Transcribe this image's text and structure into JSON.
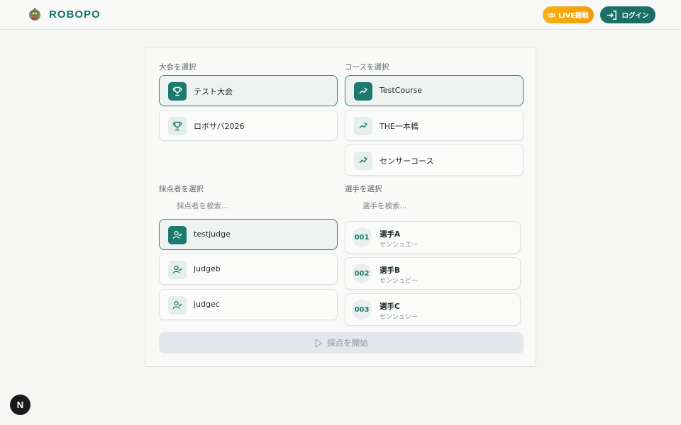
{
  "header": {
    "brand": "ROBOPO",
    "live_label": "LIVE観戦",
    "login_label": "ログイン"
  },
  "tournament": {
    "label": "大会を選択",
    "items": [
      {
        "label": "テスト大会",
        "selected": true
      },
      {
        "label": "ロボサバ2026",
        "selected": false
      }
    ]
  },
  "course": {
    "label": "コースを選択",
    "items": [
      {
        "label": "TestCourse",
        "selected": true
      },
      {
        "label": "THE一本橋",
        "selected": false
      },
      {
        "label": "センサーコース",
        "selected": false
      }
    ]
  },
  "judge": {
    "label": "採点者を選択",
    "search_placeholder": "採点者を検索...",
    "items": [
      {
        "label": "testjudge",
        "selected": true
      },
      {
        "label": "judgeb",
        "selected": false
      },
      {
        "label": "judgec",
        "selected": false
      }
    ]
  },
  "player": {
    "label": "選手を選択",
    "search_placeholder": "選手を検索...",
    "items": [
      {
        "number": "001",
        "name": "選手A",
        "kana": "センシュエー"
      },
      {
        "number": "002",
        "name": "選手B",
        "kana": "センシュビー"
      },
      {
        "number": "003",
        "name": "選手C",
        "kana": "センシュシー"
      }
    ]
  },
  "start_label": "採点を開始",
  "badge_letter": "N",
  "colors": {
    "primary": "#1c7a6d",
    "live_accent": "#f59a0a",
    "selected_border": "#2f8b7d"
  }
}
